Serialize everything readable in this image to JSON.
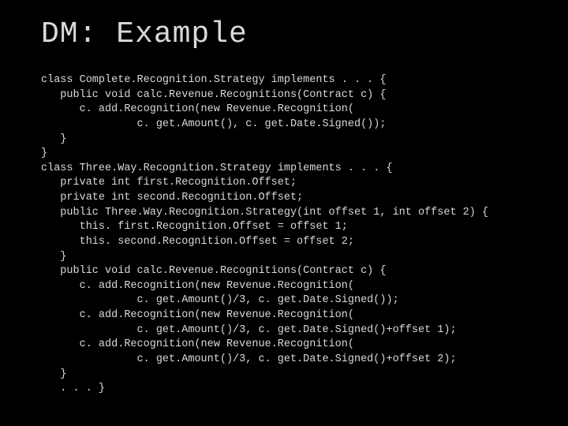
{
  "title": "DM: Example",
  "code_lines": [
    "class Complete.Recognition.Strategy implements . . . {",
    "   public void calc.Revenue.Recognitions(Contract c) {",
    "      c. add.Recognition(new Revenue.Recognition(",
    "               c. get.Amount(), c. get.Date.Signed());",
    "   }",
    "}",
    "class Three.Way.Recognition.Strategy implements . . . {",
    "   private int first.Recognition.Offset;",
    "   private int second.Recognition.Offset;",
    "   public Three.Way.Recognition.Strategy(int offset 1, int offset 2) {",
    "      this. first.Recognition.Offset = offset 1;",
    "      this. second.Recognition.Offset = offset 2;",
    "   }",
    "   public void calc.Revenue.Recognitions(Contract c) {",
    "      c. add.Recognition(new Revenue.Recognition(",
    "               c. get.Amount()/3, c. get.Date.Signed());",
    "      c. add.Recognition(new Revenue.Recognition(",
    "               c. get.Amount()/3, c. get.Date.Signed()+offset 1);",
    "      c. add.Recognition(new Revenue.Recognition(",
    "               c. get.Amount()/3, c. get.Date.Signed()+offset 2);",
    "   }",
    "   . . . }"
  ]
}
